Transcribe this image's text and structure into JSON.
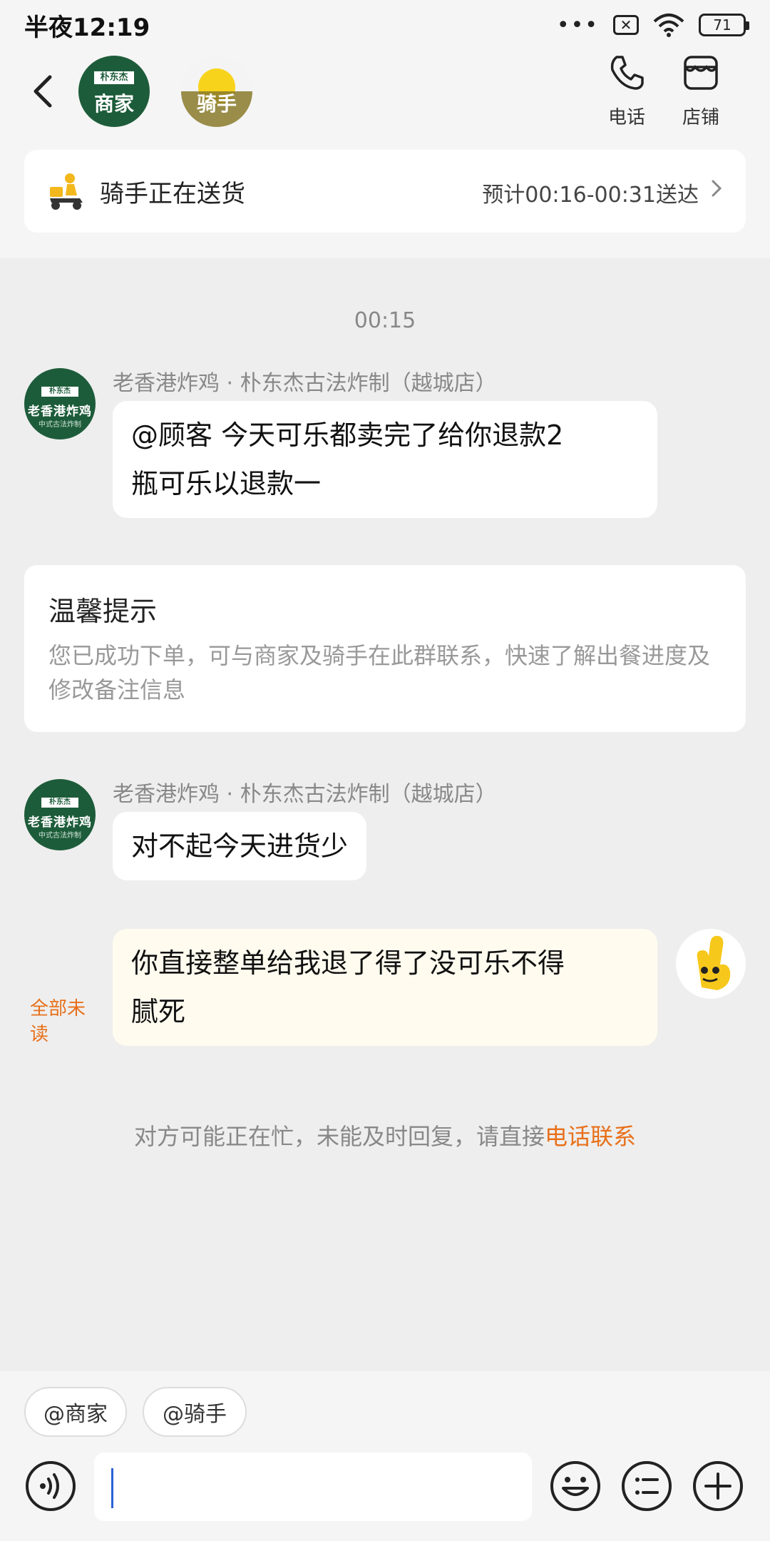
{
  "status_bar": {
    "time": "半夜12:19",
    "dots": "•••",
    "battery": "71"
  },
  "header": {
    "merchant_avatar_label": "商家",
    "merchant_tag": "朴东杰",
    "rider_avatar_label": "骑手",
    "phone_label": "电话",
    "shop_label": "店铺"
  },
  "delivery": {
    "status": "骑手正在送货",
    "eta": "预计00:16-00:31送达"
  },
  "chat": {
    "time_separator": "00:15",
    "merchant_avatar": {
      "tag": "朴东杰",
      "name": "老香港炸鸡",
      "sub": "中式古法炸制"
    },
    "msg1": {
      "sender": "老香港炸鸡 · 朴东杰古法炸制（越城店）",
      "text_line1": "@顾客 今天可乐都卖完了给你退款2",
      "text_line2": "瓶可乐以退款一"
    },
    "notice": {
      "title": "温馨提示",
      "body": "您已成功下单，可与商家及骑手在此群联系，快速了解出餐进度及修改备注信息"
    },
    "msg2": {
      "sender": "老香港炸鸡 · 朴东杰古法炸制（越城店）",
      "text": "对不起今天进货少"
    },
    "msg3": {
      "text_line1": "你直接整单给我退了得了没可乐不得",
      "text_line2": "腻死",
      "read_status": "全部未读"
    },
    "busy_prefix": "对方可能正在忙，未能及时回复，请直接",
    "busy_link": "电话联系"
  },
  "input_area": {
    "chip_merchant": "@商家",
    "chip_rider": "@骑手",
    "input_value": ""
  },
  "colors": {
    "accent_orange": "#e8701a",
    "merchant_green": "#1d5c3a",
    "mine_bubble": "#fffcef",
    "caret_blue": "#2a62d6"
  }
}
